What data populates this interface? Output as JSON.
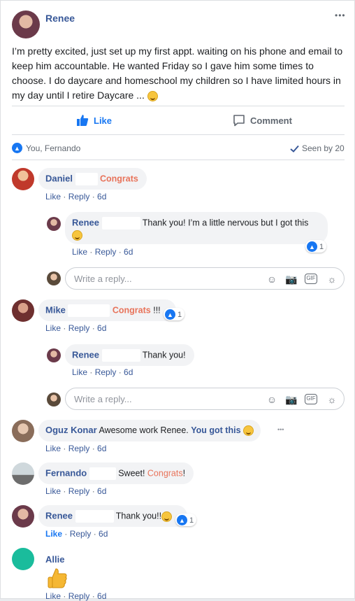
{
  "post": {
    "author": "Renee",
    "text": "I’m pretty excited, just set up my first appt. waiting on his phone and email to keep him accountable. He wanted Friday so I gave him some times to choose. I do daycare and homeschool my children so I have limited hours in my day until I retire Daycare ...",
    "menu_label": "•••"
  },
  "actions": {
    "like": "Like",
    "comment": "Comment"
  },
  "reactions": {
    "names": "You, Fernando",
    "seen": "Seen by 20"
  },
  "reply_placeholder": "Write a reply...",
  "comments": [
    {
      "name": "Daniel",
      "text": "Congrats",
      "like": "Like",
      "reply": "Reply",
      "time": "6d"
    },
    {
      "name": "Renee",
      "text": "Thank you! I’m a little nervous but I got this",
      "like": "Like",
      "reply": "Reply",
      "time": "6d",
      "count": "1"
    },
    {
      "name": "Mike",
      "text_hl": "Congrats",
      "text": " !!!",
      "like": "Like",
      "reply": "Reply",
      "time": "6d",
      "count": "1"
    },
    {
      "name": "Renee",
      "text": "Thank you!",
      "like": "Like",
      "reply": "Reply",
      "time": "6d"
    },
    {
      "name": "Oguz Konar",
      "text": "Awesome work Renee. ",
      "text_hl": "You got this",
      "like": "Like",
      "reply": "Reply",
      "time": "6d",
      "more": "•••"
    },
    {
      "name": "Fernando",
      "text": "Sweet! ",
      "text_hl": "Congrats",
      "text_end": "!",
      "like": "Like",
      "reply": "Reply",
      "time": "6d"
    },
    {
      "name": "Renee",
      "text": "Thank you!!",
      "like": "Like",
      "reply": "Reply",
      "time": "6d",
      "count": "1"
    },
    {
      "name": "Allie",
      "like": "Like",
      "reply": "Reply",
      "time": "6d"
    }
  ],
  "colors": {
    "link": "#385898",
    "accent": "#1877f2",
    "highlight": "#e8735a",
    "bubble": "#f2f3f5"
  },
  "icons": [
    "thumbs-up-icon",
    "comment-icon",
    "check-icon",
    "smiley-icon",
    "camera-icon",
    "gif-icon",
    "sticker-icon",
    "more-icon"
  ]
}
